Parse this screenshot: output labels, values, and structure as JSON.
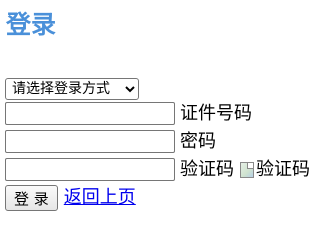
{
  "page": {
    "title": "登录"
  },
  "form": {
    "login_method": {
      "selected": "请选择登录方式",
      "options": [
        "请选择登录方式"
      ]
    },
    "id_field": {
      "value": "",
      "label": "证件号码"
    },
    "password_field": {
      "value": "",
      "label": "密码"
    },
    "captcha_field": {
      "value": "",
      "label": "验证码",
      "image_alt": "验证码"
    },
    "submit_label": "登 录",
    "back_link": "返回上页"
  },
  "colors": {
    "title": "#4a90d9",
    "link": "#0000ee"
  }
}
